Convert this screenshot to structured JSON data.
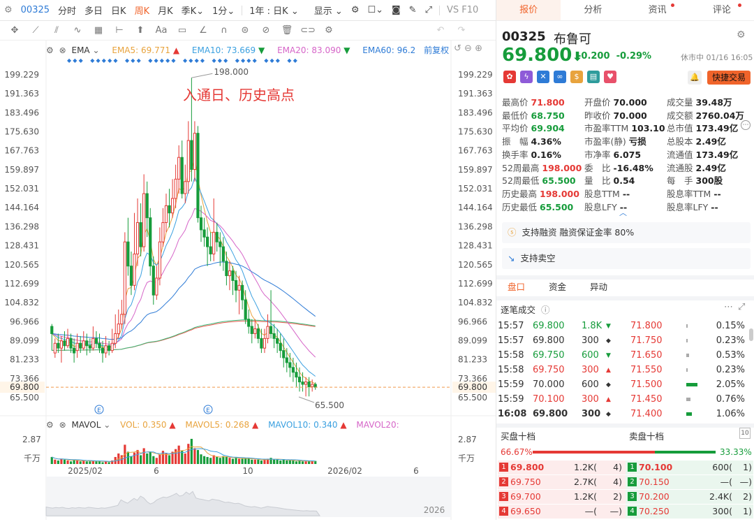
{
  "toolbar": {
    "code": "00325",
    "periods": [
      "分时",
      "多日",
      "日K",
      "周K",
      "月K",
      "季K",
      "1分"
    ],
    "active_period": "周K",
    "range_label": "1年 : 日K",
    "display_label": "显示",
    "vsf10": "VS F10"
  },
  "indicators": {
    "main_name": "EMA",
    "ema5_label": "EMA5:",
    "ema5": "69.771",
    "ema10_label": "EMA10:",
    "ema10": "73.669",
    "ema20_label": "EMA20:",
    "ema20": "83.090",
    "ema60_label": "EMA60:",
    "ema60": "96.2",
    "adjust": "前复权",
    "vol_name": "MAVOL",
    "vol_label": "VOL:",
    "vol": "0.350",
    "mavol5_label": "MAVOL5:",
    "mavol5": "0.268",
    "mavol10_label": "MAVOL10:",
    "mavol10": "0.340",
    "mavol20_label": "MAVOL20:"
  },
  "annotation": "入通日、历史高点",
  "chart_data": {
    "type": "candlestick",
    "y_ticks": [
      "199.229",
      "191.363",
      "183.496",
      "175.630",
      "167.763",
      "159.897",
      "152.031",
      "144.164",
      "136.298",
      "128.431",
      "120.565",
      "112.699",
      "104.832",
      "96.966",
      "89.099",
      "81.233",
      "73.366",
      "65.500"
    ],
    "ylim": [
      65.5,
      199.229
    ],
    "high_label": "198.000",
    "low_label": "65.500",
    "last_price": "69.800",
    "x_labels": [
      "2025/02",
      "6",
      "10",
      "2026/02",
      "6"
    ],
    "vol_ticks": [
      "2.87",
      "千万"
    ],
    "nav_label": "2026",
    "candles": [
      [
        95,
        92,
        96,
        85
      ],
      [
        84,
        88,
        90,
        82
      ],
      [
        88,
        86,
        92,
        84
      ],
      [
        86,
        89,
        91,
        80
      ],
      [
        89,
        87,
        93,
        85
      ],
      [
        87,
        90,
        94,
        86
      ],
      [
        90,
        86,
        92,
        84
      ],
      [
        86,
        84,
        90,
        80
      ],
      [
        85,
        88,
        92,
        82
      ],
      [
        88,
        86,
        91,
        84
      ],
      [
        86,
        89,
        93,
        85
      ],
      [
        89,
        87,
        92,
        83
      ],
      [
        87,
        86,
        90,
        84
      ],
      [
        86,
        90,
        95,
        85
      ],
      [
        90,
        88,
        93,
        86
      ],
      [
        88,
        86,
        92,
        84
      ],
      [
        86,
        84,
        89,
        80
      ],
      [
        84,
        87,
        91,
        82
      ],
      [
        87,
        85,
        89,
        83
      ],
      [
        85,
        88,
        94,
        84
      ],
      [
        88,
        92,
        100,
        86
      ],
      [
        92,
        96,
        102,
        90
      ],
      [
        96,
        100,
        106,
        94
      ],
      [
        100,
        130,
        134,
        96
      ],
      [
        130,
        120,
        140,
        116
      ],
      [
        120,
        112,
        126,
        108
      ],
      [
        112,
        125,
        142,
        110
      ],
      [
        125,
        138,
        148,
        120
      ],
      [
        138,
        128,
        146,
        124
      ],
      [
        128,
        150,
        158,
        126
      ],
      [
        150,
        140,
        155,
        132
      ],
      [
        140,
        120,
        144,
        116
      ],
      [
        120,
        108,
        124,
        104
      ],
      [
        108,
        115,
        120,
        106
      ],
      [
        115,
        130,
        136,
        112
      ],
      [
        130,
        138,
        144,
        128
      ],
      [
        138,
        145,
        150,
        134
      ],
      [
        145,
        142,
        152,
        136
      ],
      [
        142,
        148,
        156,
        140
      ],
      [
        148,
        156,
        162,
        144
      ],
      [
        156,
        165,
        170,
        150
      ],
      [
        165,
        150,
        172,
        148
      ],
      [
        150,
        155,
        162,
        146
      ],
      [
        155,
        172,
        180,
        150
      ],
      [
        172,
        160,
        198,
        155
      ],
      [
        160,
        175,
        180,
        155
      ],
      [
        175,
        140,
        178,
        138
      ],
      [
        140,
        135,
        145,
        130
      ],
      [
        135,
        132,
        140,
        128
      ],
      [
        132,
        128,
        136,
        120
      ],
      [
        128,
        125,
        134,
        122
      ],
      [
        125,
        134,
        148,
        122
      ],
      [
        134,
        130,
        138,
        126
      ],
      [
        130,
        128,
        134,
        120
      ],
      [
        128,
        122,
        132,
        118
      ],
      [
        122,
        116,
        126,
        112
      ],
      [
        116,
        118,
        122,
        110
      ],
      [
        118,
        114,
        120,
        108
      ],
      [
        114,
        110,
        118,
        105
      ],
      [
        110,
        112,
        116,
        100
      ],
      [
        112,
        106,
        114,
        102
      ],
      [
        106,
        98,
        110,
        96
      ],
      [
        98,
        95,
        102,
        92
      ],
      [
        95,
        92,
        98,
        88
      ],
      [
        92,
        94,
        98,
        90
      ],
      [
        94,
        90,
        96,
        88
      ],
      [
        90,
        86,
        94,
        84
      ],
      [
        86,
        90,
        94,
        84
      ],
      [
        90,
        95,
        100,
        88
      ],
      [
        95,
        92,
        110,
        90
      ],
      [
        92,
        90,
        96,
        86
      ],
      [
        90,
        88,
        94,
        84
      ],
      [
        88,
        85,
        92,
        82
      ],
      [
        85,
        82,
        90,
        78
      ],
      [
        82,
        80,
        86,
        76
      ],
      [
        80,
        78,
        84,
        74
      ],
      [
        78,
        76,
        82,
        72
      ],
      [
        76,
        74,
        80,
        70
      ],
      [
        74,
        72,
        78,
        68
      ],
      [
        72,
        71,
        76,
        68
      ],
      [
        71,
        72,
        74,
        66
      ],
      [
        72,
        70,
        74,
        66
      ],
      [
        70,
        71,
        73,
        68
      ],
      [
        71,
        69.8,
        71.8,
        68.75
      ]
    ],
    "volumes": [
      0.8,
      0.5,
      0.4,
      0.6,
      0.5,
      0.4,
      0.3,
      0.5,
      0.4,
      0.3,
      0.4,
      0.3,
      0.3,
      0.4,
      0.3,
      0.3,
      0.2,
      0.3,
      0.2,
      0.4,
      0.8,
      1.2,
      1.0,
      2.2,
      1.4,
      0.9,
      1.3,
      1.6,
      1.0,
      1.8,
      1.2,
      1.4,
      0.9,
      0.7,
      1.1,
      1.5,
      1.2,
      1.0,
      1.4,
      1.7,
      2.1,
      1.5,
      1.2,
      2.3,
      2.87,
      1.8,
      1.6,
      1.1,
      0.9,
      0.8,
      0.7,
      1.0,
      0.8,
      0.7,
      0.9,
      0.8,
      0.7,
      0.6,
      0.7,
      0.6,
      0.6,
      0.7,
      0.6,
      0.5,
      0.5,
      0.5,
      0.4,
      0.5,
      0.6,
      0.7,
      0.5,
      0.5,
      0.4,
      0.5,
      0.4,
      0.4,
      0.4,
      0.3,
      0.4,
      0.3,
      0.3,
      0.3,
      0.3,
      0.35
    ]
  },
  "quote": {
    "tabs": [
      "报价",
      "分析",
      "资讯",
      "评论"
    ],
    "code": "00325",
    "name": "布鲁可",
    "price": "69.800",
    "change": "-0.200",
    "pct": "-0.29%",
    "status": "休市中 01/16 16:05",
    "quick_trade": "快捷交易",
    "fields": [
      [
        "最高价",
        "71.800",
        "red"
      ],
      [
        "开盘价",
        "70.000",
        "dim"
      ],
      [
        "成交量",
        "39.48万",
        "dim"
      ],
      [
        "最低价",
        "68.750",
        "green"
      ],
      [
        "昨收价",
        "70.000",
        "dim"
      ],
      [
        "成交额",
        "2760.04万",
        "dim"
      ],
      [
        "平均价",
        "69.904",
        "green"
      ],
      [
        "市盈率TTM",
        "103.10",
        "dim"
      ],
      [
        "总市值",
        "173.49亿",
        "dim"
      ],
      [
        "振　幅",
        "4.36%",
        "dim"
      ],
      [
        "市盈率(静)",
        "亏损",
        "dim"
      ],
      [
        "总股本",
        "2.49亿",
        "dim"
      ],
      [
        "换手率",
        "0.16%",
        "dim"
      ],
      [
        "市净率",
        "6.075",
        "dim"
      ],
      [
        "流通值",
        "173.49亿",
        "dim"
      ],
      [
        "52周最高",
        "198.000",
        "red"
      ],
      [
        "委　比",
        "-16.48%",
        "dim"
      ],
      [
        "流通股",
        "2.49亿",
        "dim"
      ],
      [
        "52周最低",
        "65.500",
        "green"
      ],
      [
        "量　比",
        "0.54",
        "dim"
      ],
      [
        "每　手",
        "300股",
        "dim"
      ],
      [
        "历史最高",
        "198.000",
        "red"
      ],
      [
        "股息TTM",
        "--",
        "dim"
      ],
      [
        "股息率TTM",
        "--",
        "dim"
      ],
      [
        "历史最低",
        "65.500",
        "green"
      ],
      [
        "股息LFY",
        "--",
        "dim"
      ],
      [
        "股息率LFY",
        "--",
        "dim"
      ]
    ],
    "margin": "支持融资 融资保证金率 80%",
    "short": "支持卖空",
    "sub_tabs": [
      "盘口",
      "资金",
      "异动"
    ],
    "tick_title": "逐笔成交",
    "ticks": [
      [
        "15:57",
        "69.800",
        "1.8K",
        "▼",
        "green"
      ],
      [
        "15:57",
        "69.800",
        "300",
        "◆",
        "dim"
      ],
      [
        "15:58",
        "69.750",
        "600",
        "▼",
        "green"
      ],
      [
        "15:58",
        "69.750",
        "300",
        "▲",
        "red"
      ],
      [
        "15:59",
        "70.000",
        "600",
        "◆",
        "dim"
      ],
      [
        "15:59",
        "70.100",
        "300",
        "▲",
        "red"
      ],
      [
        "16:08",
        "69.800",
        "300",
        "◆",
        "dim"
      ]
    ],
    "dist": [
      [
        "71.800",
        "0.15%"
      ],
      [
        "71.750",
        "0.23%"
      ],
      [
        "71.650",
        "0.53%"
      ],
      [
        "71.550",
        "0.23%"
      ],
      [
        "71.500",
        "2.05%"
      ],
      [
        "71.450",
        "0.76%"
      ],
      [
        "71.400",
        "1.06%"
      ]
    ],
    "ob_buy_title": "买盘十档",
    "ob_sell_title": "卖盘十档",
    "buy_pct": "66.67%",
    "sell_pct": "33.33%",
    "ob_count": "10",
    "orderbook": [
      [
        "1",
        "69.800",
        "1.2K(",
        "4)",
        "1",
        "70.100",
        "600(",
        "1)"
      ],
      [
        "2",
        "69.750",
        "2.7K(",
        "4)",
        "2",
        "70.150",
        "—(",
        "—)"
      ],
      [
        "3",
        "69.700",
        "1.2K(",
        "2)",
        "3",
        "70.200",
        "2.4K(",
        "2)"
      ],
      [
        "4",
        "69.650",
        "—(",
        "—)",
        "4",
        "70.250",
        "300(",
        "1)"
      ]
    ]
  }
}
